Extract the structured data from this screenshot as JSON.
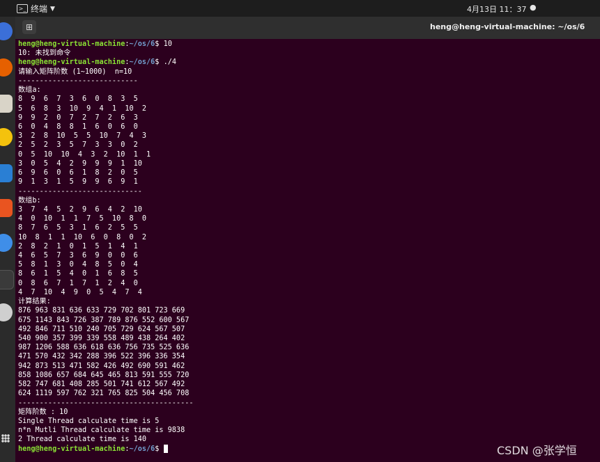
{
  "topbar": {
    "activities_label": "终端",
    "dropdown_glyph": "▼",
    "clock": "4月13日  11：37",
    "status_glyph": "●"
  },
  "window": {
    "title": "heng@heng-virtual-machine: ~/os/6",
    "newtab_glyph": "⊞"
  },
  "terminal": {
    "user_host": "heng@heng-virtual-machine",
    "path": "~/os/6",
    "lines": [
      {
        "type": "cmd",
        "cmd": " 10"
      },
      {
        "type": "out",
        "text": "10: 未找到命令"
      },
      {
        "type": "cmd",
        "cmd": " ./4"
      },
      {
        "type": "out",
        "text": "请输入矩阵阶数 (1~1000)  n=10"
      },
      {
        "type": "out",
        "text": "----------------------------"
      },
      {
        "type": "out",
        "text": "数组a:"
      },
      {
        "type": "out",
        "text": "8  9  6  7  3  6  0  8  3  5"
      },
      {
        "type": "out",
        "text": "5  6  8  3  10  9  4  1  10  2"
      },
      {
        "type": "out",
        "text": "9  9  2  0  7  2  7  2  6  3"
      },
      {
        "type": "out",
        "text": "6  0  4  8  8  1  6  0  6  0"
      },
      {
        "type": "out",
        "text": "3  2  8  10  5  5  10  7  4  3"
      },
      {
        "type": "out",
        "text": "2  5  2  3  5  7  3  3  0  2"
      },
      {
        "type": "out",
        "text": "0  5  10  10  4  3  2  10  1  1"
      },
      {
        "type": "out",
        "text": "3  0  5  4  2  9  9  9  1  10"
      },
      {
        "type": "out",
        "text": "6  9  6  0  6  1  8  2  0  5"
      },
      {
        "type": "out",
        "text": "9  1  3  1  5  9  9  6  9  1"
      },
      {
        "type": "out",
        "text": "-----------------------------"
      },
      {
        "type": "out",
        "text": "数组b:"
      },
      {
        "type": "out",
        "text": "3  7  4  5  2  9  6  4  2  10"
      },
      {
        "type": "out",
        "text": "4  0  10  1  1  7  5  10  8  0"
      },
      {
        "type": "out",
        "text": "8  7  6  5  3  1  6  2  5  5"
      },
      {
        "type": "out",
        "text": "10  8  1  1  10  6  0  8  0  2"
      },
      {
        "type": "out",
        "text": "2  8  2  1  0  1  5  1  4  1"
      },
      {
        "type": "out",
        "text": "4  6  5  7  3  6  9  0  0  6"
      },
      {
        "type": "out",
        "text": "5  8  1  3  0  4  8  5  0  4"
      },
      {
        "type": "out",
        "text": "8  6  1  5  4  0  1  6  8  5"
      },
      {
        "type": "out",
        "text": "0  8  6  7  1  7  1  2  4  0"
      },
      {
        "type": "out",
        "text": "4  7  10  4  9  0  5  4  7  4"
      },
      {
        "type": "out",
        "text": "计算结果:"
      },
      {
        "type": "out",
        "text": "876 963 831 636 633 729 702 801 723 669"
      },
      {
        "type": "out",
        "text": "675 1143 843 726 387 789 876 552 600 567"
      },
      {
        "type": "out",
        "text": "492 846 711 510 240 705 729 624 567 507"
      },
      {
        "type": "out",
        "text": "540 900 357 399 339 558 489 438 264 402"
      },
      {
        "type": "out",
        "text": "987 1206 588 636 618 636 756 735 525 636"
      },
      {
        "type": "out",
        "text": "471 570 432 342 288 396 522 396 336 354"
      },
      {
        "type": "out",
        "text": "942 873 513 471 582 426 492 690 591 462"
      },
      {
        "type": "out",
        "text": "858 1086 657 684 645 465 813 591 555 720"
      },
      {
        "type": "out",
        "text": "582 747 681 408 285 501 741 612 567 492"
      },
      {
        "type": "out",
        "text": "624 1119 597 762 321 765 825 504 456 708"
      },
      {
        "type": "out",
        "text": "-----------------------------------------"
      },
      {
        "type": "out",
        "text": "矩阵阶数 : 10"
      },
      {
        "type": "out",
        "text": "Single Thread calculate time is 5"
      },
      {
        "type": "out",
        "text": "n*n Mutli Thread calculate time is 9838"
      },
      {
        "type": "out",
        "text": "2 Thread calculate time is 140"
      },
      {
        "type": "prompt_cursor",
        "cmd": " "
      }
    ]
  },
  "watermark": "CSDN @张学恒",
  "colors": {
    "terminal_bg": "#2c001e",
    "prompt_green": "#8ae234",
    "path_blue": "#729fcf",
    "text": "#ffffff"
  },
  "dock_icons": [
    "app-icon",
    "firefox-icon",
    "files-icon",
    "rhythmbox-icon",
    "writer-icon",
    "software-center-icon",
    "help-icon",
    "terminal-icon",
    "dvd-icon",
    "show-apps-icon"
  ]
}
